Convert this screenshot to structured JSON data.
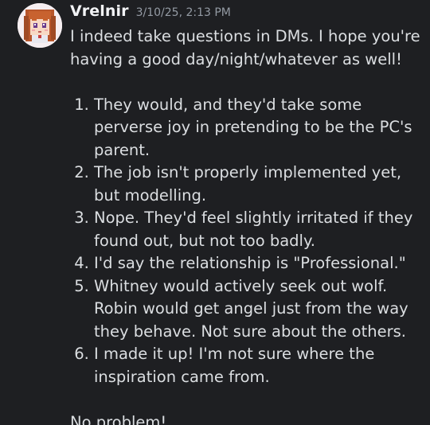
{
  "message": {
    "author": "Vrelnir",
    "timestamp": "3/10/25, 2:13 PM",
    "intro": "I indeed take questions in DMs. I hope you're having a good day/night/whatever as well!",
    "list_items": [
      "They would, and they'd take some perverse joy in pretending to be the PC's parent.",
      "The job isn't properly implemented yet, but modelling.",
      "Nope. They'd feel slightly irritated if they found out, but not too badly.",
      "I'd say the relationship is \"Professional.\"",
      "Whitney would actively seek out wolf. Robin would get angel just from the way they behave. Not sure about the others.",
      "I made it up! I'm not sure where the inspiration came from."
    ],
    "closing": "No problem!"
  },
  "colors": {
    "background": "#1e1f22",
    "username": "#f2f3f5",
    "timestamp": "#949ba4",
    "text": "#dbdee1"
  },
  "icons": {
    "avatar": "pixel-art-avatar-icon"
  }
}
